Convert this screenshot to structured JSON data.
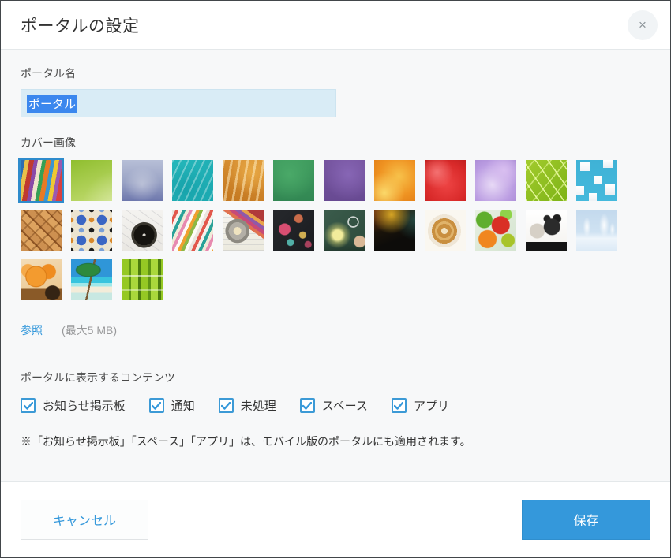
{
  "dialog": {
    "title": "ポータルの設定",
    "close_icon": "×"
  },
  "form": {
    "portal_name_label": "ポータル名",
    "portal_name_value": "ポータル",
    "cover_image_label": "カバー画像",
    "browse_label": "参照",
    "size_limit_label": "(最大5 MB)",
    "contents_label": "ポータルに表示するコンテンツ",
    "note": "※「お知らせ掲示板」「スペース」「アプリ」は、モバイル版のポータルにも適用されます。"
  },
  "colors": {
    "accent_blue": "#3498db",
    "selection_blue": "#3b87ee",
    "input_bg": "#d9ecf6",
    "body_bg": "#f7f8f9",
    "selected_thumb_border": "#2e8bcc"
  },
  "cover_thumbnails": {
    "selected_index": 0,
    "items": [
      {
        "name": "colored-pencils",
        "style": "background: linear-gradient(100deg, #2e6db0 0 9%, #e8c04a 9% 18%, #c03a30 18% 28%, #8a4aa8 28% 36%, #efe2cc 36% 45%, #35a055 45% 53%, #e87a25 53% 63%, #3a96d0 63% 71%, #efc832 71% 80%, #9a5ab0 80% 88%, #d84040 88% 100%)"
      },
      {
        "name": "green-curves",
        "style": "background: radial-gradient(circle at 115% 115%, rgba(255,255,255,0.35), transparent 55%), linear-gradient(160deg, #8fbe2e, #c3dc72)"
      },
      {
        "name": "blue-gray-gradient",
        "style": "background: radial-gradient(circle at 50% 60%, rgba(255,255,255,0.35), transparent 55%), linear-gradient(180deg, #b7bfd7 0%, #99a2c4 55%, #6d77ad 100%)"
      },
      {
        "name": "teal-paint",
        "style": "background: repeating-linear-gradient(115deg, rgba(255,255,255,0.35) 0 2px, transparent 2px 9px), radial-gradient(circle at 30% 70%, #17a3ab, transparent 60%), linear-gradient(135deg, #25b7ba, #1ba8b0)"
      },
      {
        "name": "orange-grunge",
        "style": "background: repeating-linear-gradient(100deg, rgba(255,236,190,0.55) 0 3px, transparent 3px 10px), radial-gradient(circle at 70% 30%, #e8a945, transparent 55%), linear-gradient(200deg, #dd9638, #c2761f)"
      },
      {
        "name": "green-fabric",
        "style": "background: radial-gradient(circle at 40% 35%, #4aa968, transparent 70%), linear-gradient(180deg, #3f9c5e, #328753)"
      },
      {
        "name": "purple-fabric",
        "style": "background: radial-gradient(circle at 60% 35%, #8766b5, transparent 70%), linear-gradient(180deg, #76549f, #684a92)"
      },
      {
        "name": "orange-flower",
        "style": "background: radial-gradient(circle at 25% 80%, #fbd96a, transparent 45%), radial-gradient(circle at 60% 40%, #f7c24b, #ef9322 55%, #e07a15)"
      },
      {
        "name": "red-flower",
        "style": "background: radial-gradient(circle at 30% 30%, #f47272, transparent 40%), radial-gradient(circle at 52% 58%, #ee4444, #d92a2a 65%, #bf1f1f)"
      },
      {
        "name": "purple-flower",
        "style": "background: radial-gradient(circle at 70% 25%, #d9bff0, transparent 45%), radial-gradient(circle at 42% 60%, #e8daf6, #bb9de2 60%, #a687d2)"
      },
      {
        "name": "green-leaf",
        "style": "background: repeating-linear-gradient(55deg, rgba(240,255,170,0.85) 0 1.5px, transparent 1.5px 13px), repeating-linear-gradient(-50deg, rgba(235,250,160,0.6) 0 1.5px, transparent 1.5px 16px), linear-gradient(135deg, #a2cb2d, #7db317)"
      },
      {
        "name": "blue-cubes",
        "style": "background: linear-gradient(#ffffff,#f1f4f7) 5px 2px/12px 12px no-repeat, linear-gradient(#ffffff,#e9eef3) 34px 0/13px 10px no-repeat, linear-gradient(#ffffff,#f5f7f9) 22px 20px/11px 11px no-repeat, linear-gradient(#ffffff,#eef2f6) 0 33px/10px 12px no-repeat, linear-gradient(#ffffff,#e8edf2) 37px 31px/12px 13px no-repeat, linear-gradient(#ffffff,#eef1f5) 16px 42px/10px 10px no-repeat, linear-gradient(180deg, #3fb2d6, #45b9dc)"
      },
      {
        "name": "wood-weave",
        "style": "background: repeating-linear-gradient(-45deg, rgba(110,60,20,0.4) 0 2px, transparent 2px 13px), repeating-linear-gradient(45deg, #cd9050 0 8px, #a66a30 8px 10px, #dda35f 10px 18px, #8f5524 18px 20px)"
      },
      {
        "name": "mosaic-tiles",
        "style": "background: radial-gradient(circle, #3a66c4 0 6px, transparent 6.5px) 0 0/26px 26px, radial-gradient(circle, #1c1c1c 0 3px, transparent 3.5px) 13px 13px/26px 26px, radial-gradient(circle, #d8882a 0 3px, transparent 3.5px) 13px 0/26px 26px, radial-gradient(circle, #7aa0d8 0 3px, transparent 3.5px) 0 13px/26px 26px, linear-gradient(#ece4d0,#ece4d0)"
      },
      {
        "name": "compass-map",
        "style": "background: radial-gradient(circle at 55% 62%, #d8d4cc 0 2px, #15130f 2px 13px, #3a372f 13px 16px, transparent 16.5px), repeating-linear-gradient(35deg, rgba(140,140,150,0.22) 0 1px, transparent 1px 9px), linear-gradient(180deg, #f4f3f0, #e9e7e2)"
      },
      {
        "name": "books-stack",
        "style": "background: repeating-linear-gradient(115deg, #eae6df 0 4px, #e2574b 4px 8px, #f5f2ec 8px 12px, #2aa198 12px 16px, #f0ead8 16px 20px, #e78ab0 20px 24px, #fdfbf7 24px 28px, #f0a030 28px 32px, #8cb845 32px 36px, #fdfbf7 36px 40px)"
      },
      {
        "name": "gear-blueprint",
        "style": "background: radial-gradient(circle at 36% 52%, #efe3c0 0 5px, #b3afa6 5px 11px, #8d8a81 11px 15px, transparent 15.5px), linear-gradient(35deg, transparent 0 58%, #e0714f 58% 64%, #c74a78 64% 70%, #9059a8 70% 76%, #e8a24a 76% 82%, #b03a3a 82% 100%), repeating-linear-gradient(0deg, rgba(150,155,165,0.25) 0 1px, transparent 1px 7px), linear-gradient(180deg, #f7f5f1, #eceade)"
      },
      {
        "name": "chalkboard-questions",
        "style": "background: radial-gradient(circle at 28% 48%, rgba(226,80,118,0.95) 0 7px, transparent 8px), radial-gradient(circle at 62% 22%, rgba(230,120,80,0.85) 0 5px, transparent 6px), radial-gradient(circle at 72% 62%, rgba(240,200,90,0.85) 0 4px, transparent 5px), radial-gradient(circle at 42% 80%, rgba(90,200,190,0.85) 0 4px, transparent 5px), radial-gradient(circle at 85% 85%, rgba(226,80,118,0.7) 0 4px, transparent 5px), linear-gradient(135deg, #26282c, #1a1c20)"
      },
      {
        "name": "lightbulbs-chalkboard",
        "style": "background: radial-gradient(circle at 34% 62%, rgba(252,244,160,0.95) 0 6px, rgba(230,225,120,0.45) 10px, transparent 17px), radial-gradient(circle at 72% 30%, transparent 0 5.5px, rgba(255,255,255,0.75) 5.5px 7px, transparent 7.5px), radial-gradient(circle at 88% 78%, #d9b897 0 7px, transparent 8px), linear-gradient(0deg, rgba(0,0,0,0.25), transparent 30%), linear-gradient(135deg, #3b5c4c, #2c4a3b)"
      },
      {
        "name": "dark-gold-gradient",
        "style": "background: radial-gradient(circle at 42% 12%, rgba(232,180,40,0.9), transparent 45%), radial-gradient(circle at 100% 25%, rgba(45,115,110,0.55), transparent 40%), radial-gradient(circle at 0% 0%, rgba(150,60,20,0.6), transparent 40%), linear-gradient(160deg, #30200a, #0d0c0a 70%)"
      },
      {
        "name": "latte-heart",
        "style": "background: radial-gradient(circle at 48% 52%, #f2e3c0 0 4px, #c98f3f 4px 9px, #e0b36a 9px 12px, #c98f3f 12px 16px, #efe6d6 16px 21px, #faf7f0 21px), linear-gradient(180deg, #f6f2ea, #efe9df)"
      },
      {
        "name": "vegetables",
        "style": "background: radial-gradient(circle at 62% 38%, #d93025 0 11px, transparent 12px), radial-gradient(circle at 30% 72%, #f0861f 0 11px, transparent 12px), radial-gradient(circle at 80% 75%, #a8c42a 0 8px, transparent 9px), radial-gradient(circle at 22% 25%, #5fae2d 0 10px, transparent 11px), radial-gradient(circle at 75% 12%, #8fd44a 0 7px, transparent 8px), linear-gradient(135deg, #e8f0e2, #d4e4d0)"
      },
      {
        "name": "dog",
        "style": "background: radial-gradient(circle at 64% 42%, #2b2b2b 0 10px, transparent 11px), radial-gradient(circle at 76% 22%, #1e1e1e 0 5px, transparent 6px), radial-gradient(circle at 52% 22%, #242424 0 4px, transparent 5px), radial-gradient(circle at 28% 52%, #d6d0c6 0 9px, transparent 10px), linear-gradient(#141414,#141414) 0 100%/100% 11px no-repeat, linear-gradient(#ffffff,#f4f2ee)"
      },
      {
        "name": "winter-trees",
        "style": "background: radial-gradient(ellipse 7px 18px at 26% 42%, rgba(255,255,255,0.95), transparent 70%), radial-gradient(ellipse 9px 22px at 68% 38%, rgba(255,255,255,0.9), transparent 70%), radial-gradient(ellipse 5px 12px at 88% 48%, rgba(255,255,255,0.8), transparent 70%), linear-gradient(180deg, #c3d9ed 0%, #cfe2f2 55%, #eef5fb 70%, #dceaf6 100%)"
      },
      {
        "name": "pumpkins-basket",
        "style": "background: radial-gradient(circle at 38% 42%, #f39b2f 0 12px, #d97a14 13px, transparent 14px), radial-gradient(circle at 68% 30%, #ef8c1f 0 9px, transparent 10px), radial-gradient(circle at 18% 28%, #f5aa4a 0 8px, transparent 9px), radial-gradient(circle at 78% 82%, #352414 0 9px, transparent 10px), linear-gradient(0deg, #8a5a28 0 28%, transparent 28%), linear-gradient(160deg, #f3ddb8, #e8c288)"
      },
      {
        "name": "palm-beach",
        "style": "background: radial-gradient(ellipse 22px 12px at 42% 26%, #2d8a3e 0 60%, rgba(29,107,48,0.85) 70%, transparent 75%), linear-gradient(102deg, transparent 0 46%, #7a5a35 46% 50%, transparent 50%), linear-gradient(180deg, #2f96d8 0 42%, #38c4de 42% 58%, #9fe8ea 58% 66%, #f3ecd9 66% 82%, #c8e8e2 82%)"
      },
      {
        "name": "bamboo",
        "style": "background: linear-gradient(rgba(255,255,255,0.55),rgba(255,255,255,0.55)) 0 40%/100% 2px no-repeat, linear-gradient(rgba(255,255,255,0.4),rgba(255,255,255,0.4)) 0 75%/100% 2px no-repeat, repeating-linear-gradient(90deg, #95c824 0 9px, #5f9414 9px 12px, #aad83c 12px 21px, #4c7c0e 21px 25px)"
      }
    ]
  },
  "checkboxes": [
    {
      "name": "notice-board",
      "label": "お知らせ掲示板",
      "checked": true
    },
    {
      "name": "notifications",
      "label": "通知",
      "checked": true
    },
    {
      "name": "unprocessed",
      "label": "未処理",
      "checked": true
    },
    {
      "name": "spaces",
      "label": "スペース",
      "checked": true
    },
    {
      "name": "apps",
      "label": "アプリ",
      "checked": true
    }
  ],
  "footer": {
    "cancel_label": "キャンセル",
    "save_label": "保存"
  }
}
